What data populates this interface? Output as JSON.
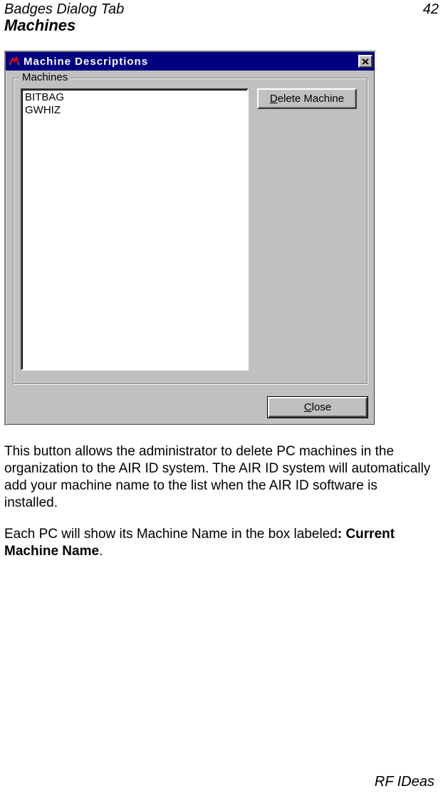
{
  "header": {
    "left": "Badges Dialog Tab",
    "right": "42"
  },
  "section_title": "Machines",
  "dialog": {
    "title": "Machine Descriptions",
    "groupbox_label": "Machines",
    "machines": [
      "BITBAG",
      "GWHIZ"
    ],
    "delete_button": {
      "pre": "",
      "accel": "D",
      "post": "elete Machine"
    },
    "close_button": {
      "pre": "",
      "accel": "C",
      "post": "lose"
    }
  },
  "body": {
    "p1": "This button allows the administrator to delete PC machines in the organization to the AIR ID system.  The AIR ID system will automatically add your machine name to the list when the AIR ID software is installed.",
    "p2_pre": "Each PC will show its Machine Name in the box labeled",
    "p2_bold": ":  Current Machine Name",
    "p2_post": "."
  },
  "footer": "RF IDeas"
}
